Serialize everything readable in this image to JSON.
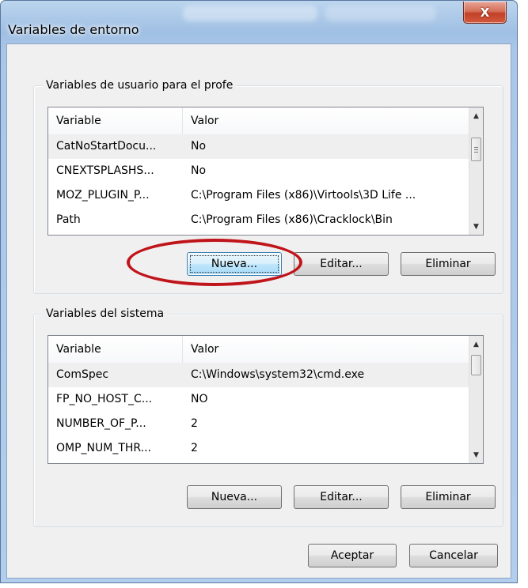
{
  "window": {
    "title": "Variables de entorno",
    "close_label": "X"
  },
  "user_group": {
    "title": "Variables de usuario para el profe",
    "columns": {
      "variable": "Variable",
      "value": "Valor"
    },
    "rows": [
      {
        "variable": "CatNoStartDocu...",
        "value": "No"
      },
      {
        "variable": "CNEXTSPLASHS...",
        "value": "No"
      },
      {
        "variable": "MOZ_PLUGIN_P...",
        "value": "C:\\Program Files (x86)\\Virtools\\3D Life ..."
      },
      {
        "variable": "Path",
        "value": "C:\\Program Files (x86)\\Cracklock\\Bin"
      }
    ],
    "buttons": {
      "new": "Nueva...",
      "edit": "Editar...",
      "delete": "Eliminar"
    }
  },
  "system_group": {
    "title": "Variables del sistema",
    "columns": {
      "variable": "Variable",
      "value": "Valor"
    },
    "rows": [
      {
        "variable": "ComSpec",
        "value": "C:\\Windows\\system32\\cmd.exe"
      },
      {
        "variable": "FP_NO_HOST_C...",
        "value": "NO"
      },
      {
        "variable": "NUMBER_OF_P...",
        "value": "2"
      },
      {
        "variable": "OMP_NUM_THR...",
        "value": "2"
      }
    ],
    "buttons": {
      "new": "Nueva...",
      "edit": "Editar...",
      "delete": "Eliminar"
    }
  },
  "footer": {
    "ok": "Aceptar",
    "cancel": "Cancelar"
  },
  "annotation": {
    "color": "#c0141b",
    "target": "Nueva..."
  }
}
